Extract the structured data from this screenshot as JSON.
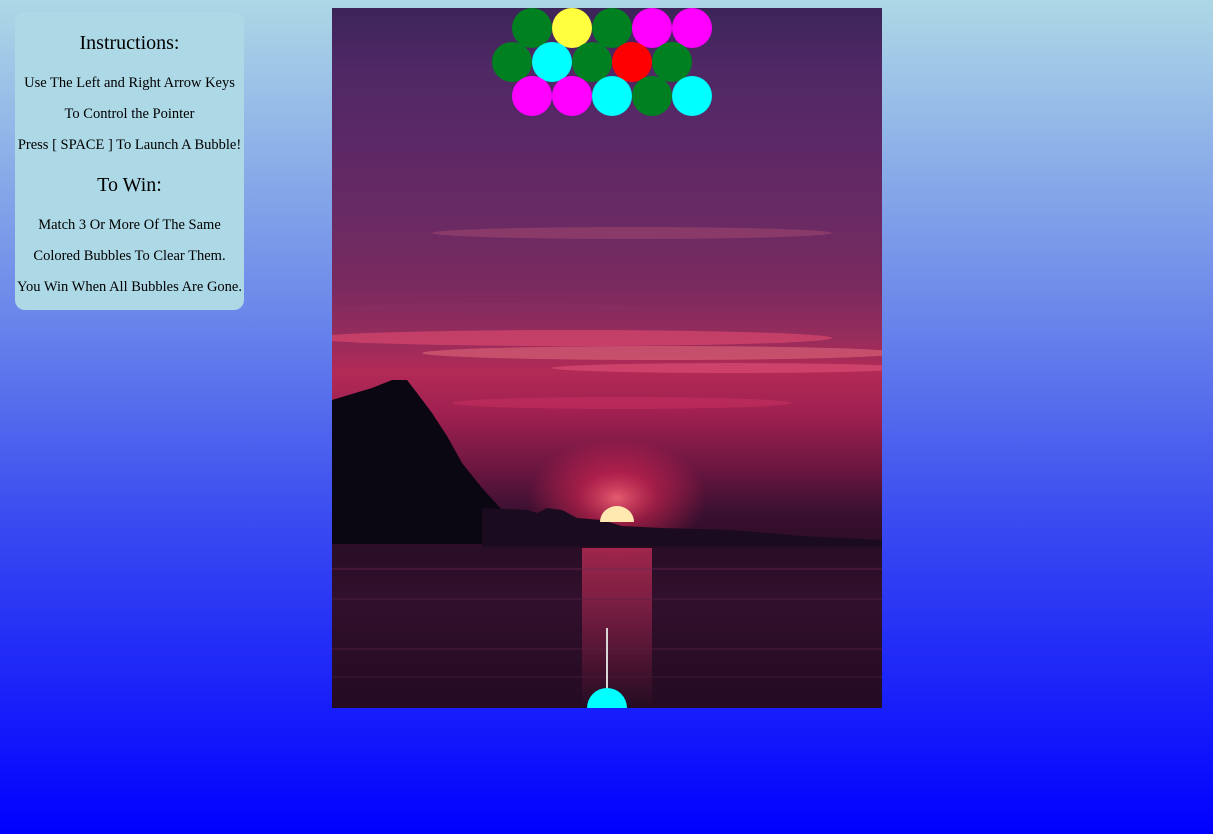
{
  "instructions": {
    "title": "Instructions:",
    "lines": [
      "Use The Left and Right Arrow Keys",
      "To Control the Pointer",
      "Press [ SPACE ] To Launch A Bubble!"
    ]
  },
  "win": {
    "title": "To Win:",
    "lines": [
      "Match 3 Or More Of The Same",
      "Colored Bubbles To Clear Them.",
      "You Win When All Bubbles Are Gone."
    ]
  },
  "colors": {
    "green": "#008020",
    "yellow": "#ffff40",
    "magenta": "#ff00ff",
    "cyan": "#00ffff",
    "red": "#ff0000"
  },
  "grid": {
    "rows": [
      [
        "green",
        "yellow",
        "green",
        "magenta",
        "magenta"
      ],
      [
        "green",
        "cyan",
        "green",
        "red",
        "green"
      ],
      [
        "magenta",
        "magenta",
        "cyan",
        "green",
        "cyan"
      ]
    ]
  },
  "shooter": {
    "bubble_color": "cyan"
  }
}
